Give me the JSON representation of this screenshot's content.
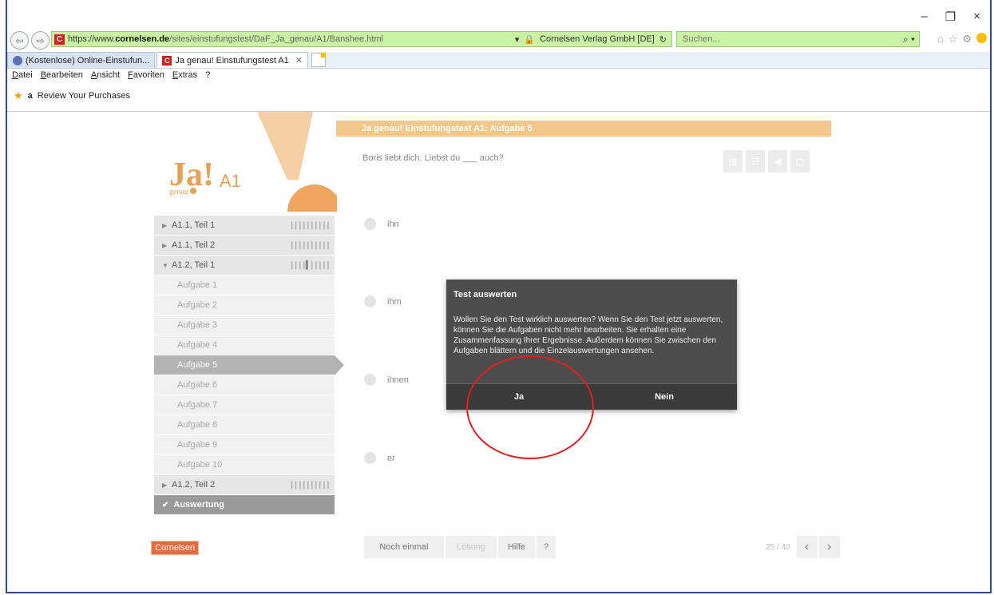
{
  "window": {
    "minimize": "–",
    "restore": "❐",
    "close": "×"
  },
  "browser": {
    "url_prefix": "https://www.",
    "url_host": "cornelsen.de",
    "url_path": "/sites/einstufungstest/DaF_Ja_genau/A1/Banshee.html",
    "site_identity": "Cornelsen Verlag GmbH [DE]",
    "search_placeholder": "Suchen...",
    "favicon_letter": "C"
  },
  "tabs": [
    {
      "label": "(Kostenlose) Online-Einstufun..."
    },
    {
      "label": "Ja genau! Einstufungstest A1"
    }
  ],
  "menu": [
    "Datei",
    "Bearbeiten",
    "Ansicht",
    "Favoriten",
    "Extras",
    "?"
  ],
  "favorites": {
    "item": "Review Your Purchases"
  },
  "logo": {
    "ja": "Ja",
    "genau": "genau",
    "level": "A1"
  },
  "sidebar": {
    "sections": [
      {
        "label": "A1.1, Teil 1",
        "progress": "||||||||||"
      },
      {
        "label": "A1.1, Teil 2",
        "progress": "||||||||||"
      },
      {
        "label": "A1.2, Teil 1",
        "progress": "||||▌|||||"
      }
    ],
    "items": [
      "Aufgabe 1",
      "Aufgabe 2",
      "Aufgabe 3",
      "Aufgabe 4",
      "Aufgabe 5",
      "Aufgabe 6",
      "Aufgabe 7",
      "Aufgabe 8",
      "Aufgabe 9",
      "Aufgabe 10"
    ],
    "active_item": "Aufgabe 5",
    "section_after": {
      "label": "A1.2, Teil 2",
      "progress": "||||||||||"
    },
    "result": "Auswertung"
  },
  "task": {
    "header": "Ja genau! Einstufungstest A1:  Aufgabe 5",
    "question": "Boris liebt dich. Liebst du ___ auch?",
    "options": [
      "ihn",
      "ihm",
      "ihnen",
      "er"
    ]
  },
  "bottom": {
    "again": "Noch einmal",
    "solution": "Lösung",
    "help": "Hilfe",
    "question_mark": "?",
    "counter": "25 / 40"
  },
  "brand": "Cornelsen",
  "modal": {
    "title": "Test auswerten",
    "body": "Wollen Sie den Test wirklich auswerten? Wenn Sie den Test jetzt auswerten, können Sie die Aufgaben nicht mehr bearbeiten. Sie erhalten eine Zusammenfassung Ihrer Ergebnisse. Außerdem können Sie zwischen den Aufgaben blättern und die Einzelauswertungen ansehen.",
    "yes": "Ja",
    "no": "Nein"
  },
  "colors": {
    "accent": "#f1c78a",
    "brand": "#e56a40",
    "annotation": "#e02020"
  }
}
